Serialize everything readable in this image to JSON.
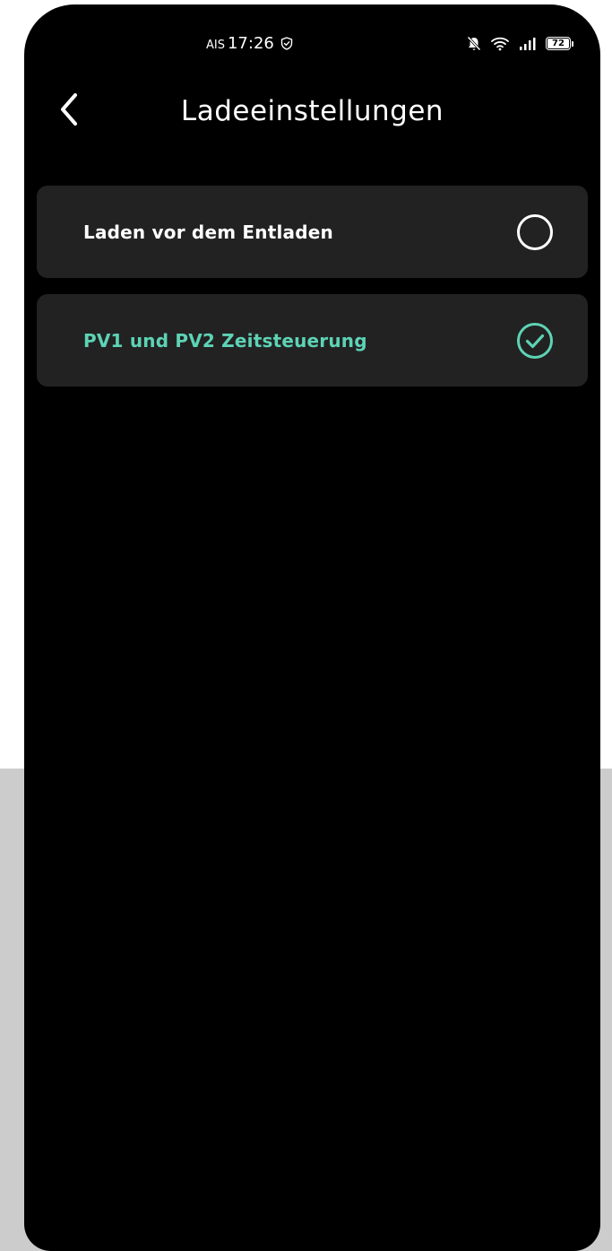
{
  "status_bar": {
    "carrier": "AIS",
    "time": "17:26",
    "battery_level": "72",
    "icons": [
      "shield-check-icon",
      "bell-off-icon",
      "wifi-icon",
      "signal-icon",
      "battery-icon"
    ]
  },
  "header": {
    "title": "Ladeeinstellungen",
    "back_icon": "chevron-left-icon"
  },
  "options": [
    {
      "label": "Laden vor dem Entladen",
      "selected": false
    },
    {
      "label": "PV1 und PV2 Zeitsteuerung",
      "selected": true
    }
  ],
  "colors": {
    "background": "#000000",
    "card": "#222222",
    "accent": "#5dd3b5",
    "text": "#ffffff",
    "outer_lower": "#cccccc"
  }
}
